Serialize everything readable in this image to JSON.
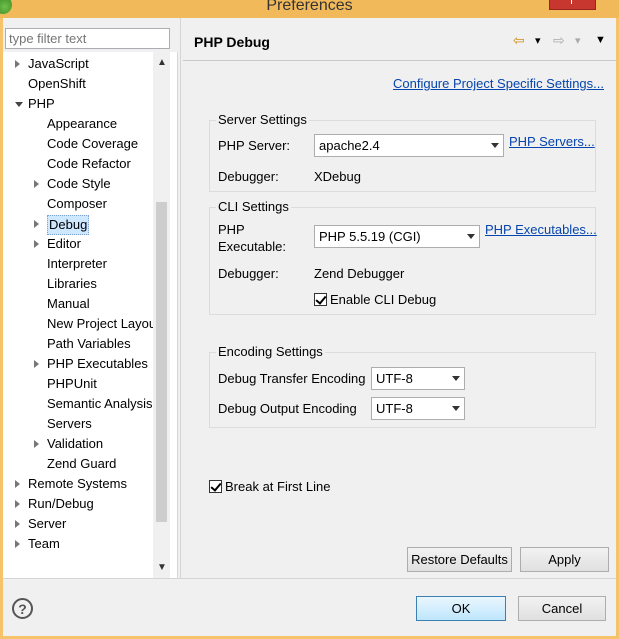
{
  "window": {
    "title": "Preferences"
  },
  "filter": {
    "placeholder": "type filter text"
  },
  "tree": [
    {
      "label": "JavaScript",
      "indent": 0,
      "twisty": "closed"
    },
    {
      "label": "OpenShift",
      "indent": 0,
      "twisty": "none"
    },
    {
      "label": "PHP",
      "indent": 0,
      "twisty": "open"
    },
    {
      "label": "Appearance",
      "indent": 1,
      "twisty": "none"
    },
    {
      "label": "Code Coverage",
      "indent": 1,
      "twisty": "none"
    },
    {
      "label": "Code Refactor",
      "indent": 1,
      "twisty": "none"
    },
    {
      "label": "Code Style",
      "indent": 1,
      "twisty": "closed"
    },
    {
      "label": "Composer",
      "indent": 1,
      "twisty": "none"
    },
    {
      "label": "Debug",
      "indent": 1,
      "twisty": "closed",
      "selected": true
    },
    {
      "label": "Editor",
      "indent": 1,
      "twisty": "closed"
    },
    {
      "label": "Interpreter",
      "indent": 1,
      "twisty": "none"
    },
    {
      "label": "Libraries",
      "indent": 1,
      "twisty": "none"
    },
    {
      "label": "Manual",
      "indent": 1,
      "twisty": "none"
    },
    {
      "label": "New Project Layou",
      "indent": 1,
      "twisty": "none"
    },
    {
      "label": "Path Variables",
      "indent": 1,
      "twisty": "none"
    },
    {
      "label": "PHP Executables",
      "indent": 1,
      "twisty": "closed"
    },
    {
      "label": "PHPUnit",
      "indent": 1,
      "twisty": "none"
    },
    {
      "label": "Semantic Analysis",
      "indent": 1,
      "twisty": "none"
    },
    {
      "label": "Servers",
      "indent": 1,
      "twisty": "none"
    },
    {
      "label": "Validation",
      "indent": 1,
      "twisty": "closed"
    },
    {
      "label": "Zend Guard",
      "indent": 1,
      "twisty": "none"
    },
    {
      "label": "Remote Systems",
      "indent": 0,
      "twisty": "closed"
    },
    {
      "label": "Run/Debug",
      "indent": 0,
      "twisty": "closed"
    },
    {
      "label": "Server",
      "indent": 0,
      "twisty": "closed"
    },
    {
      "label": "Team",
      "indent": 0,
      "twisty": "closed"
    }
  ],
  "page": {
    "title": "PHP Debug",
    "configure_link": "Configure Project Specific Settings...",
    "server_settings": {
      "legend": "Server Settings",
      "server_label": "PHP Server:",
      "server_value": "apache2.4",
      "servers_link": "PHP Servers...",
      "debugger_label": "Debugger:",
      "debugger_value": "XDebug"
    },
    "cli_settings": {
      "legend": "CLI Settings",
      "exec_label_1": "PHP",
      "exec_label_2": "Executable:",
      "exec_value": "PHP 5.5.19 (CGI)",
      "executables_link": "PHP Executables...",
      "debugger_label": "Debugger:",
      "debugger_value": "Zend Debugger",
      "enable_cli_label": "Enable CLI Debug"
    },
    "encoding_settings": {
      "legend": "Encoding Settings",
      "transfer_label": "Debug Transfer Encoding",
      "transfer_value": "UTF-8",
      "output_label": "Debug Output Encoding",
      "output_value": "UTF-8"
    },
    "break_first_line": "Break at First Line",
    "restore_defaults": "Restore Defaults",
    "apply": "Apply"
  },
  "dialog": {
    "ok": "OK",
    "cancel": "Cancel",
    "help_glyph": "?"
  },
  "nav_glyphs": {
    "back": "⇦",
    "forward": "⇨",
    "dropdown": "▾",
    "menu": "▼"
  },
  "scroll_glyphs": {
    "up": "▲",
    "down": "▼",
    "left": "◀",
    "right": "▶"
  }
}
